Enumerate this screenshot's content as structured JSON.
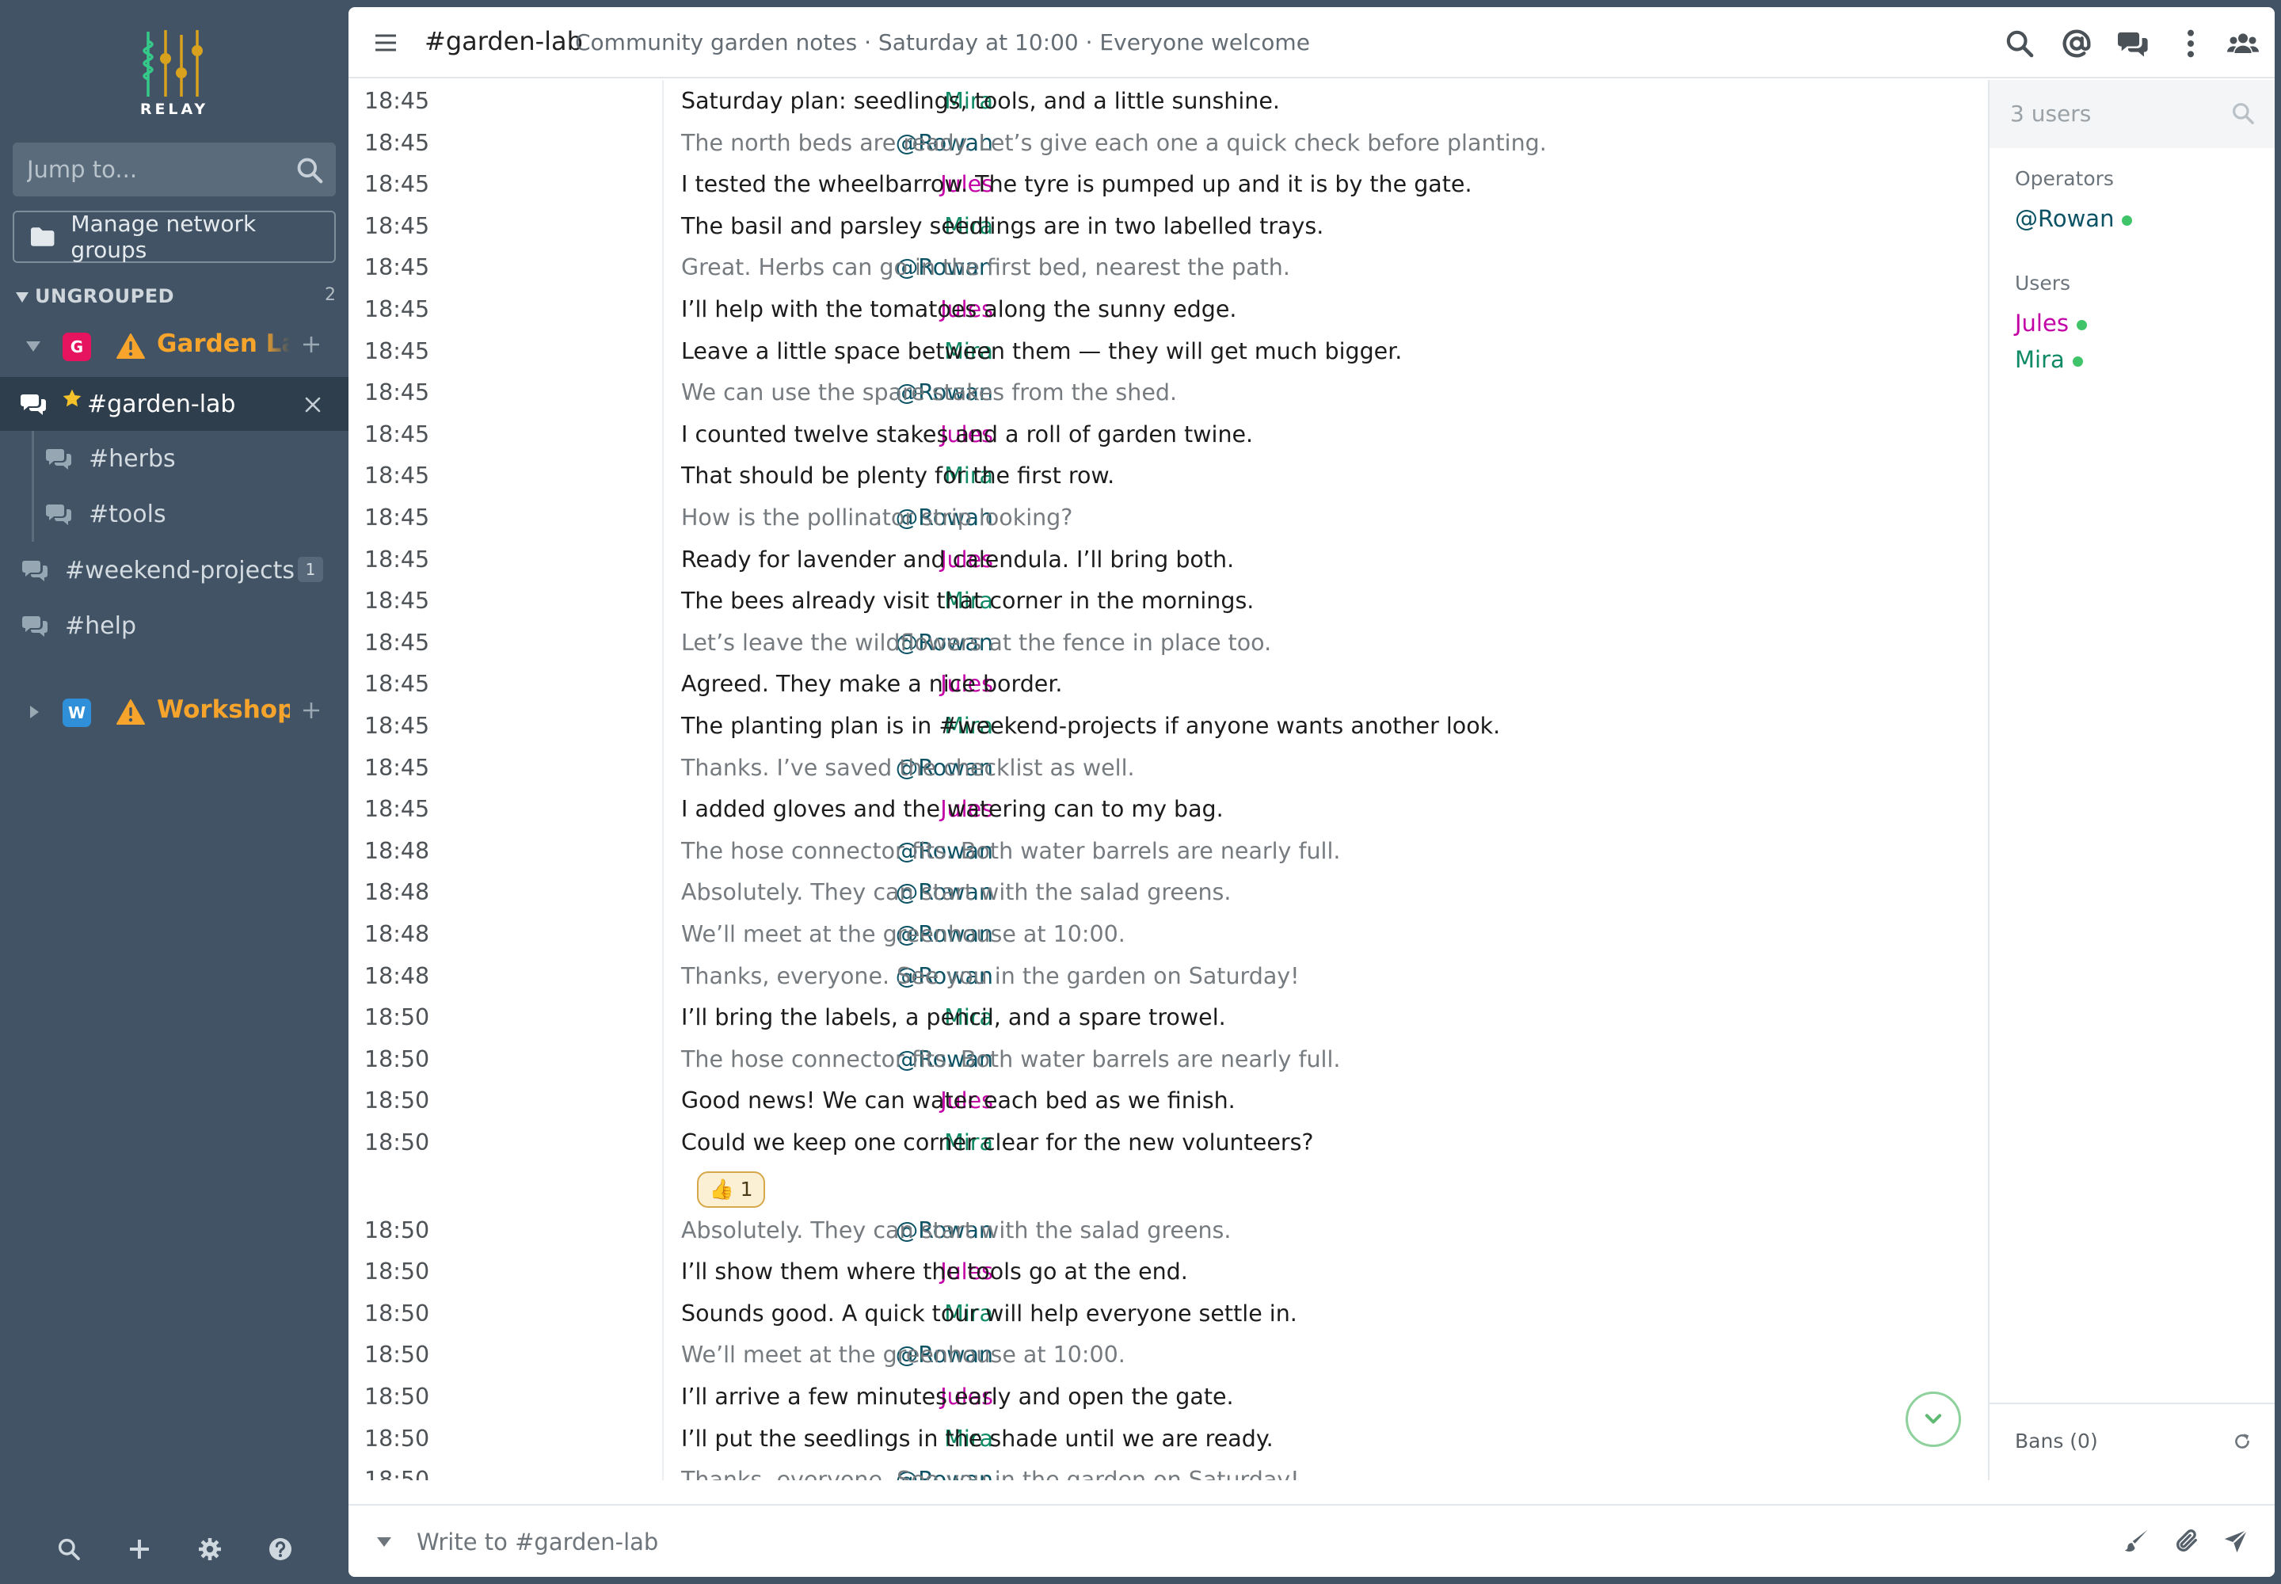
{
  "sidebar": {
    "logo_text": "RELAY",
    "jump_placeholder": "Jump to...",
    "manage_groups_label": "Manage network groups",
    "group": {
      "label": "UNGROUPED",
      "count": "2"
    },
    "networks": [
      {
        "avatar": "G",
        "avatar_color": "#e6135e",
        "name": "Garden Lab",
        "warning": true,
        "expanded": true
      },
      {
        "avatar": "W",
        "avatar_color": "#2f8fd8",
        "name": "Workshop",
        "warning": true,
        "expanded": false
      }
    ],
    "channels": {
      "active": {
        "name": "#garden-lab",
        "starred": true
      },
      "herbs": {
        "name": "#herbs"
      },
      "tools": {
        "name": "#tools"
      },
      "weekend": {
        "name": "#weekend-projects",
        "badge": "1"
      },
      "help": {
        "name": "#help"
      }
    },
    "footer_icons": [
      "search-icon",
      "plus-icon",
      "gear-icon",
      "help-icon"
    ]
  },
  "header": {
    "title": "#garden-lab",
    "topic": "Community garden notes · Saturday at 10:00 · Everyone welcome",
    "icons": [
      "search-icon",
      "mention-icon",
      "chat-icon",
      "more-icon",
      "users-icon"
    ]
  },
  "nick_colors": {
    "Mira": "#0f8a64",
    "@Rowan": "#0c5265",
    "Jules": "#c200a5"
  },
  "messages": [
    {
      "time": "18:45",
      "nick": "Mira",
      "text": "Saturday plan: seedlings, tools, and a little sunshine."
    },
    {
      "time": "18:45",
      "nick": "@Rowan",
      "text": "The north beds are ready. Let’s give each one a quick check before planting."
    },
    {
      "time": "18:45",
      "nick": "Jules",
      "text": "I tested the wheelbarrow. The tyre is pumped up and it is by the gate."
    },
    {
      "time": "18:45",
      "nick": "Mira",
      "text": "The basil and parsley seedlings are in two labelled trays."
    },
    {
      "time": "18:45",
      "nick": "@Rowan",
      "text": "Great. Herbs can go in the first bed, nearest the path."
    },
    {
      "time": "18:45",
      "nick": "Jules",
      "text": "I’ll help with the tomatoes along the sunny edge."
    },
    {
      "time": "18:45",
      "nick": "Mira",
      "text": "Leave a little space between them — they will get much bigger."
    },
    {
      "time": "18:45",
      "nick": "@Rowan",
      "text": "We can use the spare stakes from the shed."
    },
    {
      "time": "18:45",
      "nick": "Jules",
      "text": "I counted twelve stakes and a roll of garden twine."
    },
    {
      "time": "18:45",
      "nick": "Mira",
      "text": "That should be plenty for the first row."
    },
    {
      "time": "18:45",
      "nick": "@Rowan",
      "text": "How is the pollinator strip looking?"
    },
    {
      "time": "18:45",
      "nick": "Jules",
      "text": "Ready for lavender and calendula. I’ll bring both."
    },
    {
      "time": "18:45",
      "nick": "Mira",
      "text": "The bees already visit that corner in the mornings."
    },
    {
      "time": "18:45",
      "nick": "@Rowan",
      "text": "Let’s leave the wildflowers at the fence in place too."
    },
    {
      "time": "18:45",
      "nick": "Jules",
      "text": "Agreed. They make a nice border."
    },
    {
      "time": "18:45",
      "nick": "Mira",
      "text": "The planting plan is in #weekend-projects if anyone wants another look."
    },
    {
      "time": "18:45",
      "nick": "@Rowan",
      "text": "Thanks. I’ve saved the checklist as well."
    },
    {
      "time": "18:45",
      "nick": "Jules",
      "text": "I added gloves and the watering can to my bag."
    },
    {
      "time": "18:48",
      "nick": "@Rowan",
      "text": "The hose connector fits. Both water barrels are nearly full."
    },
    {
      "time": "18:48",
      "nick": "@Rowan",
      "text": "Absolutely. They can start with the salad greens."
    },
    {
      "time": "18:48",
      "nick": "@Rowan",
      "text": "We’ll meet at the greenhouse at 10:00."
    },
    {
      "time": "18:48",
      "nick": "@Rowan",
      "text": "Thanks, everyone. See you in the garden on Saturday!"
    },
    {
      "time": "18:50",
      "nick": "Mira",
      "text": "I’ll bring the labels, a pencil, and a spare trowel."
    },
    {
      "time": "18:50",
      "nick": "@Rowan",
      "text": "The hose connector fits. Both water barrels are nearly full."
    },
    {
      "time": "18:50",
      "nick": "Jules",
      "text": "Good news! We can water each bed as we finish."
    },
    {
      "time": "18:50",
      "nick": "Mira",
      "text": "Could we keep one corner clear for the new volunteers?",
      "reaction": "👍 1"
    },
    {
      "time": "18:50",
      "nick": "@Rowan",
      "text": "Absolutely. They can start with the salad greens."
    },
    {
      "time": "18:50",
      "nick": "Jules",
      "text": "I’ll show them where the tools go at the end."
    },
    {
      "time": "18:50",
      "nick": "Mira",
      "text": "Sounds good. A quick tour will help everyone settle in."
    },
    {
      "time": "18:50",
      "nick": "@Rowan",
      "text": "We’ll meet at the greenhouse at 10:00."
    },
    {
      "time": "18:50",
      "nick": "Jules",
      "text": "I’ll arrive a few minutes early and open the gate."
    },
    {
      "time": "18:50",
      "nick": "Mira",
      "text": "I’ll put the seedlings in the shade until we are ready."
    },
    {
      "time": "18:50",
      "nick": "@Rowan",
      "text": "Thanks, everyone. See you in the garden on Saturday!"
    }
  ],
  "userlist": {
    "search_placeholder": "3 users",
    "operators_heading": "Operators",
    "operators": [
      {
        "nick": "@Rowan",
        "online": true
      }
    ],
    "users_heading": "Users",
    "users": [
      {
        "nick": "Jules",
        "online": true
      },
      {
        "nick": "Mira",
        "online": true
      }
    ],
    "bans_label": "Bans (0)"
  },
  "composer": {
    "placeholder": "Write to #garden-lab",
    "icons": [
      "brush-icon",
      "paperclip-icon",
      "send-icon"
    ]
  },
  "colors": {
    "sidebar_bg": "#415364",
    "active_channel_bg": "#2f3e4c",
    "warning": "#f6a42b",
    "online": "#3fc469"
  }
}
